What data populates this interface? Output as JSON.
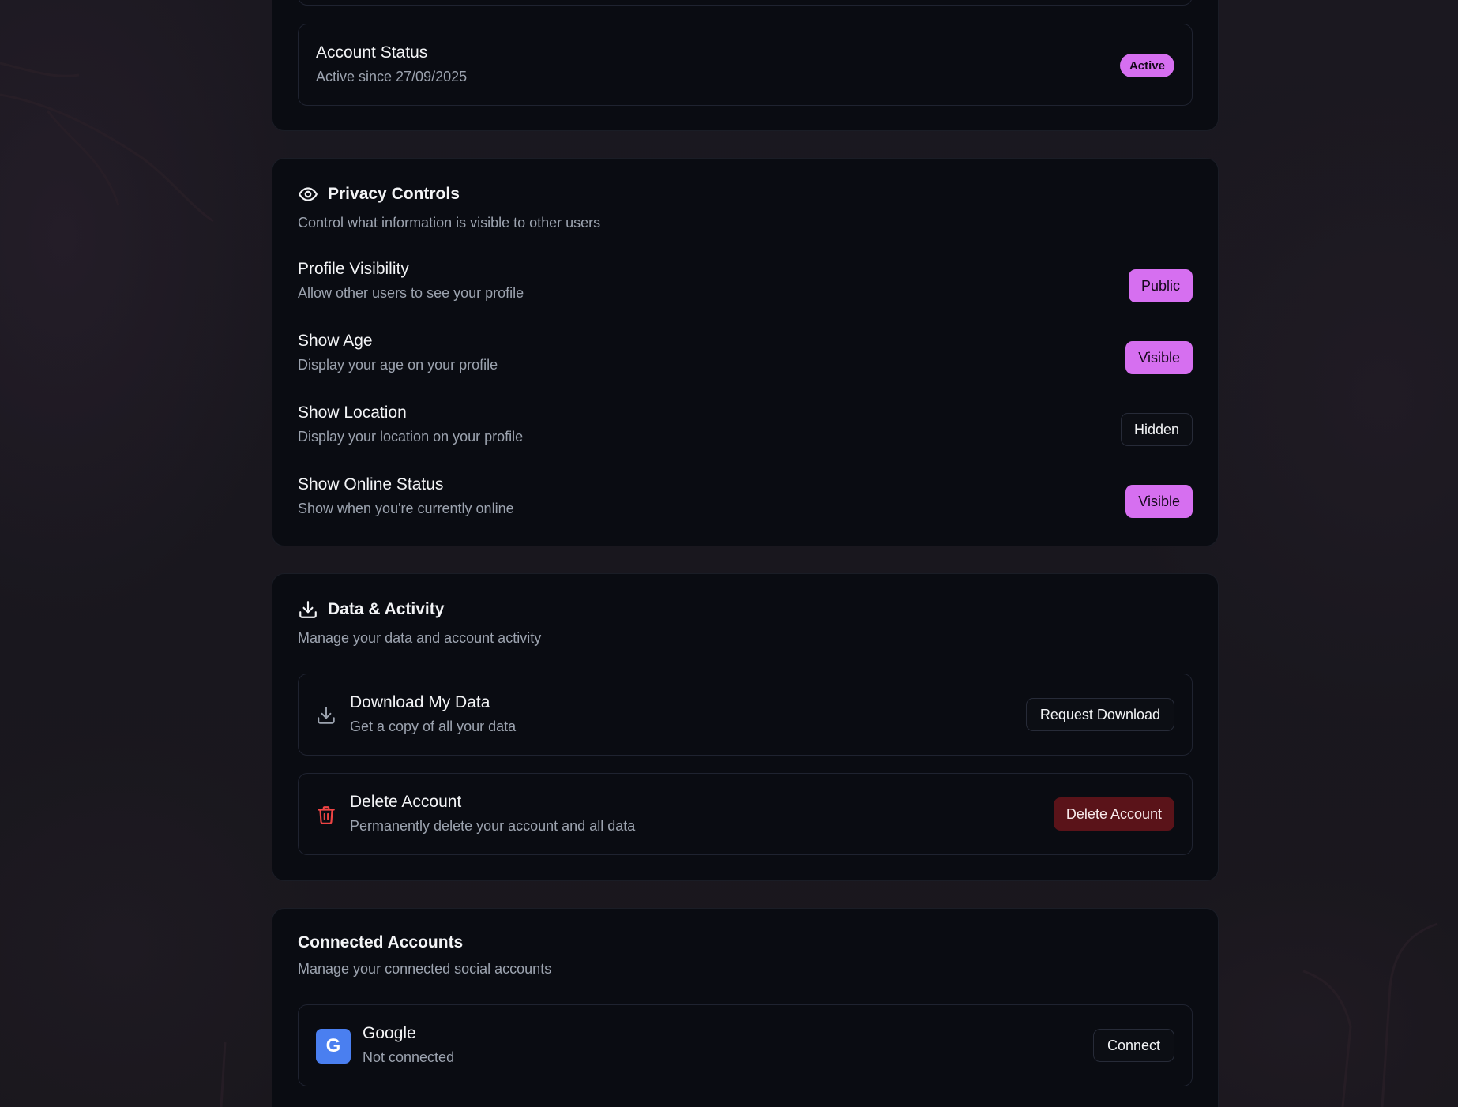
{
  "account_status": {
    "title": "Account Status",
    "subtitle": "Active since 27/09/2025",
    "badge": "Active"
  },
  "privacy": {
    "icon": "eye-icon",
    "title": "Privacy Controls",
    "subtitle": "Control what information is visible to other users",
    "rows": [
      {
        "title": "Profile Visibility",
        "subtitle": "Allow other users to see your profile",
        "value": "Public",
        "state": "on"
      },
      {
        "title": "Show Age",
        "subtitle": "Display your age on your profile",
        "value": "Visible",
        "state": "on"
      },
      {
        "title": "Show Location",
        "subtitle": "Display your location on your profile",
        "value": "Hidden",
        "state": "off"
      },
      {
        "title": "Show Online Status",
        "subtitle": "Show when you're currently online",
        "value": "Visible",
        "state": "on"
      }
    ]
  },
  "data_activity": {
    "icon": "download-icon",
    "title": "Data & Activity",
    "subtitle": "Manage your data and account activity",
    "download": {
      "title": "Download My Data",
      "subtitle": "Get a copy of all your data",
      "button": "Request Download"
    },
    "delete": {
      "title": "Delete Account",
      "subtitle": "Permanently delete your account and all data",
      "button": "Delete Account"
    }
  },
  "connected": {
    "title": "Connected Accounts",
    "subtitle": "Manage your connected social accounts",
    "google": {
      "logo_letter": "G",
      "name": "Google",
      "status": "Not connected",
      "button": "Connect"
    }
  },
  "colors": {
    "accent": "#d66ff0",
    "danger_bg": "#5a1319",
    "danger_icon": "#ef4444",
    "google_blue": "#4a7ff0",
    "card_bg": "#0a0c12"
  }
}
